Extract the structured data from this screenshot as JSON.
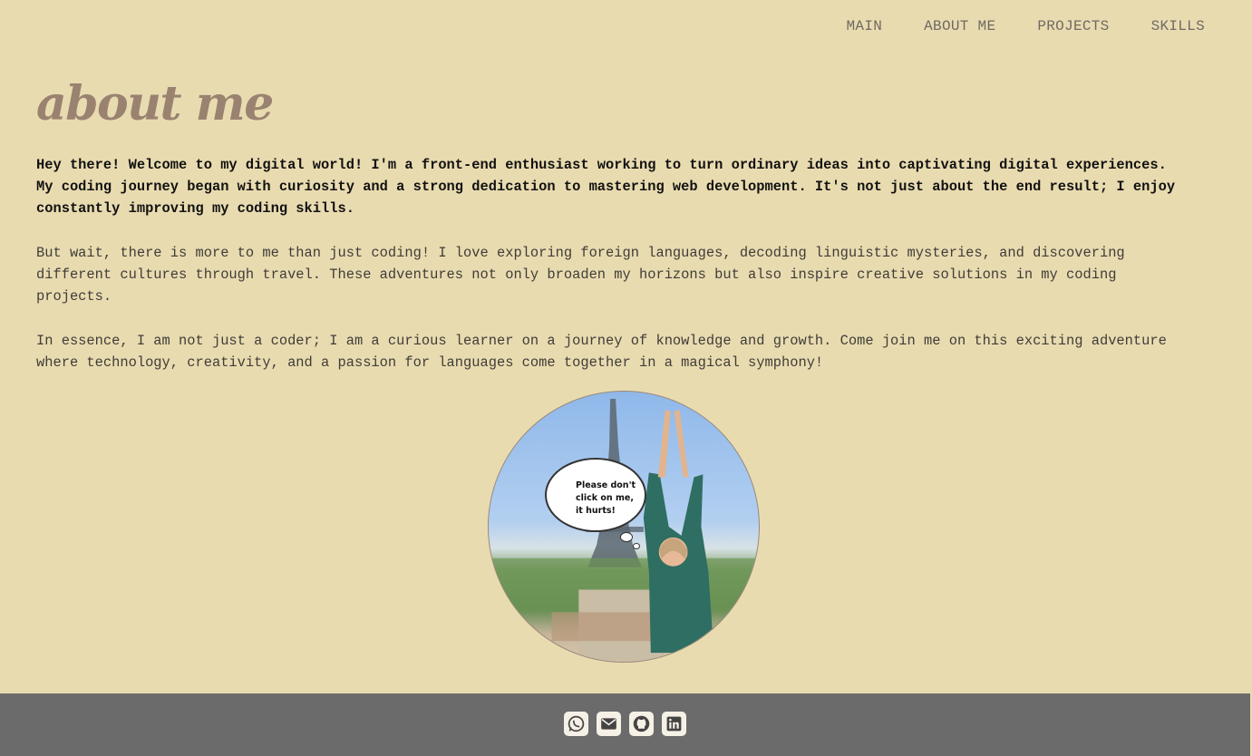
{
  "nav": {
    "items": [
      {
        "label": "MAIN"
      },
      {
        "label": "ABOUT ME"
      },
      {
        "label": "PROJECTS"
      },
      {
        "label": "SKILLS"
      }
    ]
  },
  "page": {
    "title": "about me",
    "paragraphs": [
      "Hey there! Welcome to my digital world! I'm a front-end enthusiast working to turn ordinary ideas into captivating digital experiences. My coding journey began with curiosity and a strong dedication to mastering web development. It's not just about the end result; I enjoy constantly improving my coding skills.",
      "But wait, there is more to me than just coding! I love exploring foreign languages, decoding linguistic mysteries, and discovering different cultures through travel. These adventures not only broaden my horizons but also inspire creative solutions in my coding projects.",
      "In essence, I am not just a coder; I am a curious learner on a journey of knowledge and growth. Come join me on this exciting adventure where technology, creativity, and a passion for languages come together in a magical symphony!"
    ]
  },
  "photo": {
    "speech_bubble": "Please don't click on me, it hurts!"
  },
  "footer": {
    "icons": [
      "whatsapp-icon",
      "email-icon",
      "github-icon",
      "linkedin-icon"
    ]
  },
  "colors": {
    "background": "#e9dbb0",
    "title": "#9a8270",
    "nav_text": "#6f6a63",
    "footer": "#6b6b6b"
  }
}
